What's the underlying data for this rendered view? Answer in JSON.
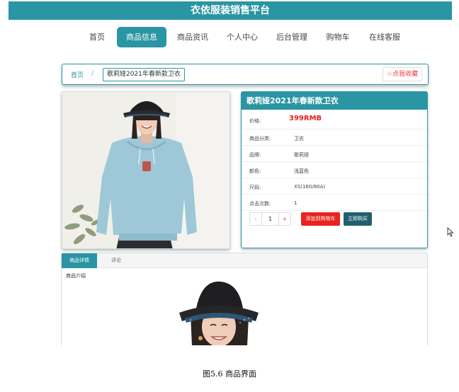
{
  "site": {
    "title": "衣依服装销售平台"
  },
  "nav": {
    "items": [
      {
        "label": "首页"
      },
      {
        "label": "商品信息"
      },
      {
        "label": "商品资讯"
      },
      {
        "label": "个人中心"
      },
      {
        "label": "后台管理"
      },
      {
        "label": "购物车"
      },
      {
        "label": "在线客服"
      }
    ],
    "active_index": 1
  },
  "breadcrumb": {
    "home": "首页",
    "separator": "/",
    "current": "歌莉娅2021年春新款卫衣",
    "favorite_label": "☆点我收藏"
  },
  "product": {
    "title": "歌莉娅2021年春新款卫衣",
    "price_label": "价格:",
    "price": "399RMB",
    "attributes": [
      {
        "label": "商品分类:",
        "value": "卫衣"
      },
      {
        "label": "品牌:",
        "value": "歌莉娅"
      },
      {
        "label": "颜色:",
        "value": "浅蓝色"
      },
      {
        "label": "尺码:",
        "value": "XS(160/80A)"
      },
      {
        "label": "点击次数:",
        "value": "1"
      }
    ],
    "quantity": {
      "minus": "-",
      "value": "1",
      "plus": "+"
    },
    "add_to_cart_label": "添加到购物车",
    "buy_now_label": "立即购买"
  },
  "details": {
    "tabs": [
      {
        "label": "商品详情"
      },
      {
        "label": "评论"
      }
    ],
    "intro_label": "商品介绍"
  },
  "caption": "图5.6  商品界面",
  "colors": {
    "accent": "#2a95a3",
    "price": "#e8231f",
    "buy": "#21606c"
  }
}
